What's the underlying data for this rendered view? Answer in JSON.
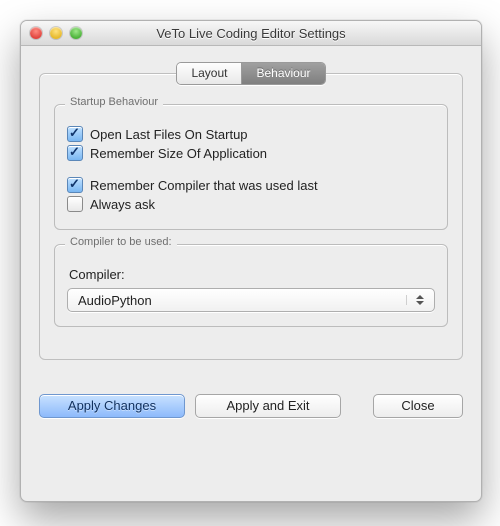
{
  "window": {
    "title": "VeTo Live Coding Editor Settings"
  },
  "tabs": {
    "layout": "Layout",
    "behaviour": "Behaviour",
    "active": "behaviour"
  },
  "startup_group": {
    "legend": "Startup Behaviour",
    "open_last_files": {
      "label": "Open Last Files On Startup",
      "checked": true
    },
    "remember_size": {
      "label": "Remember Size Of Application",
      "checked": true
    },
    "remember_compiler": {
      "label": "Remember Compiler that was used last",
      "checked": true
    },
    "always_ask": {
      "label": "Always ask",
      "checked": false
    }
  },
  "compiler_group": {
    "legend": "Compiler to be used:",
    "field_label": "Compiler:",
    "selected": "AudioPython"
  },
  "buttons": {
    "apply": "Apply Changes",
    "apply_exit": "Apply and Exit",
    "close": "Close"
  }
}
